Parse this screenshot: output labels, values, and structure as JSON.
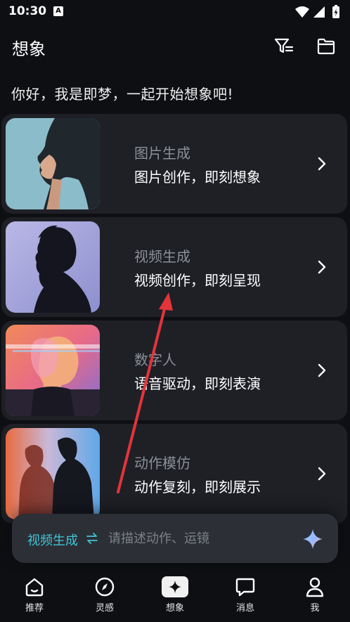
{
  "status_bar": {
    "time": "10:30",
    "badge": "A",
    "icons": [
      "wifi-icon",
      "signal-icon",
      "battery-icon"
    ]
  },
  "header": {
    "title": "想象",
    "icons": [
      "filter-icon",
      "folder-icon"
    ]
  },
  "greeting": "你好，我是即梦，一起开始想象吧!",
  "cards": [
    {
      "title": "图片生成",
      "desc": "图片创作，即刻想象"
    },
    {
      "title": "视频生成",
      "desc": "视频创作，即刻呈现"
    },
    {
      "title": "数字人",
      "desc": "语音驱动，即刻表演"
    },
    {
      "title": "动作模仿",
      "desc": "动作复刻，即刻展示"
    }
  ],
  "prompt_bar": {
    "mode": "视频生成",
    "mode_icon": "swap-icon",
    "placeholder": "请描述动作、运镜",
    "value": "",
    "send_icon": "sparkle-icon"
  },
  "bottom_nav": [
    {
      "label": "推荐",
      "icon": "home-icon",
      "active": false
    },
    {
      "label": "灵感",
      "icon": "compass-icon",
      "active": false
    },
    {
      "label": "想象",
      "icon": "sparkle-icon",
      "active": true
    },
    {
      "label": "消息",
      "icon": "chat-icon",
      "active": false
    },
    {
      "label": "我",
      "icon": "user-icon",
      "active": false
    }
  ],
  "colors": {
    "background": "#0e0f13",
    "card": "#1e2026",
    "accent": "#3ec6d8",
    "annotation_arrow": "#e3343a"
  }
}
